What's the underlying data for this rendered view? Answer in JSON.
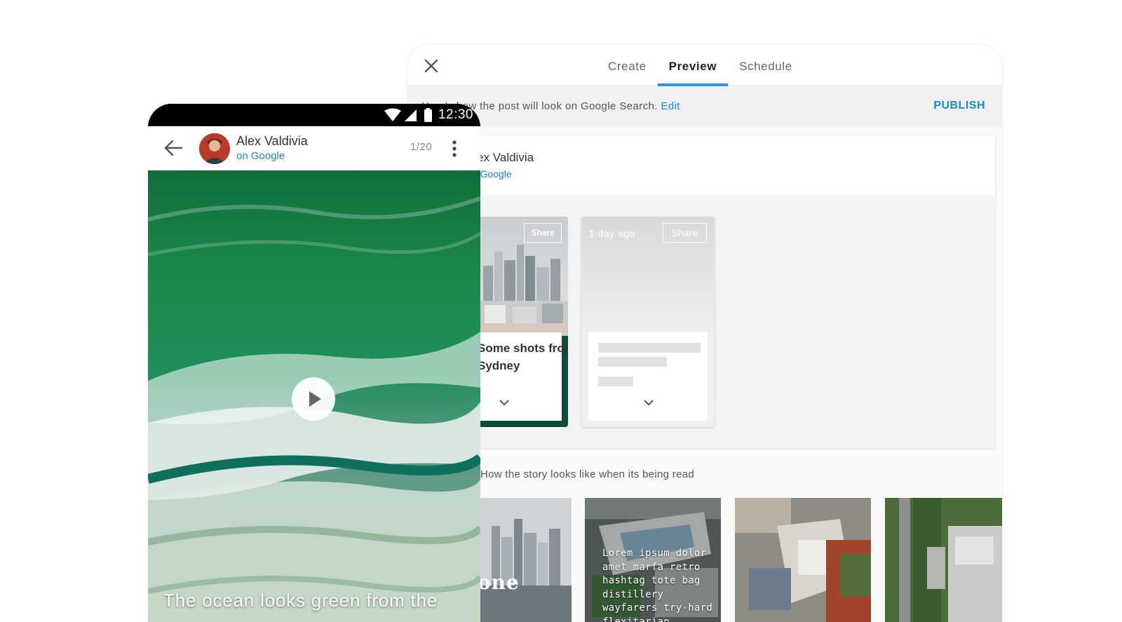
{
  "editor": {
    "tabs": [
      {
        "label": "Create"
      },
      {
        "label": "Preview"
      },
      {
        "label": "Schedule"
      }
    ],
    "active_tab": "Preview",
    "info_text": "Here's how the post will look on Google Search.",
    "info_edit": "Edit",
    "publish_label": "PUBLISH",
    "author_name": "Alex Valdivia",
    "author_sub": "on Google",
    "story_cards": [
      {
        "share_label": "Share",
        "title": "Some shots from\nSydney"
      },
      {
        "time": "1 day ago",
        "share_label": "Share"
      }
    ],
    "reading_label": "How the story looks like when its being read",
    "pages": [
      {
        "big_text": "one"
      },
      {
        "text": "Lorem ipsum dolor amet marfa retro hashtag tote bag distillery wayfarers try-hard flexitarian"
      }
    ]
  },
  "phone": {
    "time": "12:30",
    "author_name": "Alex Valdivia",
    "author_sub": "on Google",
    "counter": "1/20",
    "caption": "The ocean looks green from the"
  },
  "colors": {
    "accent": "#2196f3",
    "link": "#1a88d8",
    "ocean_green": "#1f8a4e"
  },
  "icons": [
    "close-icon",
    "back-arrow-icon",
    "more-vert-icon",
    "play-icon",
    "wifi-icon",
    "signal-icon",
    "battery-icon",
    "chevron-down-icon"
  ]
}
